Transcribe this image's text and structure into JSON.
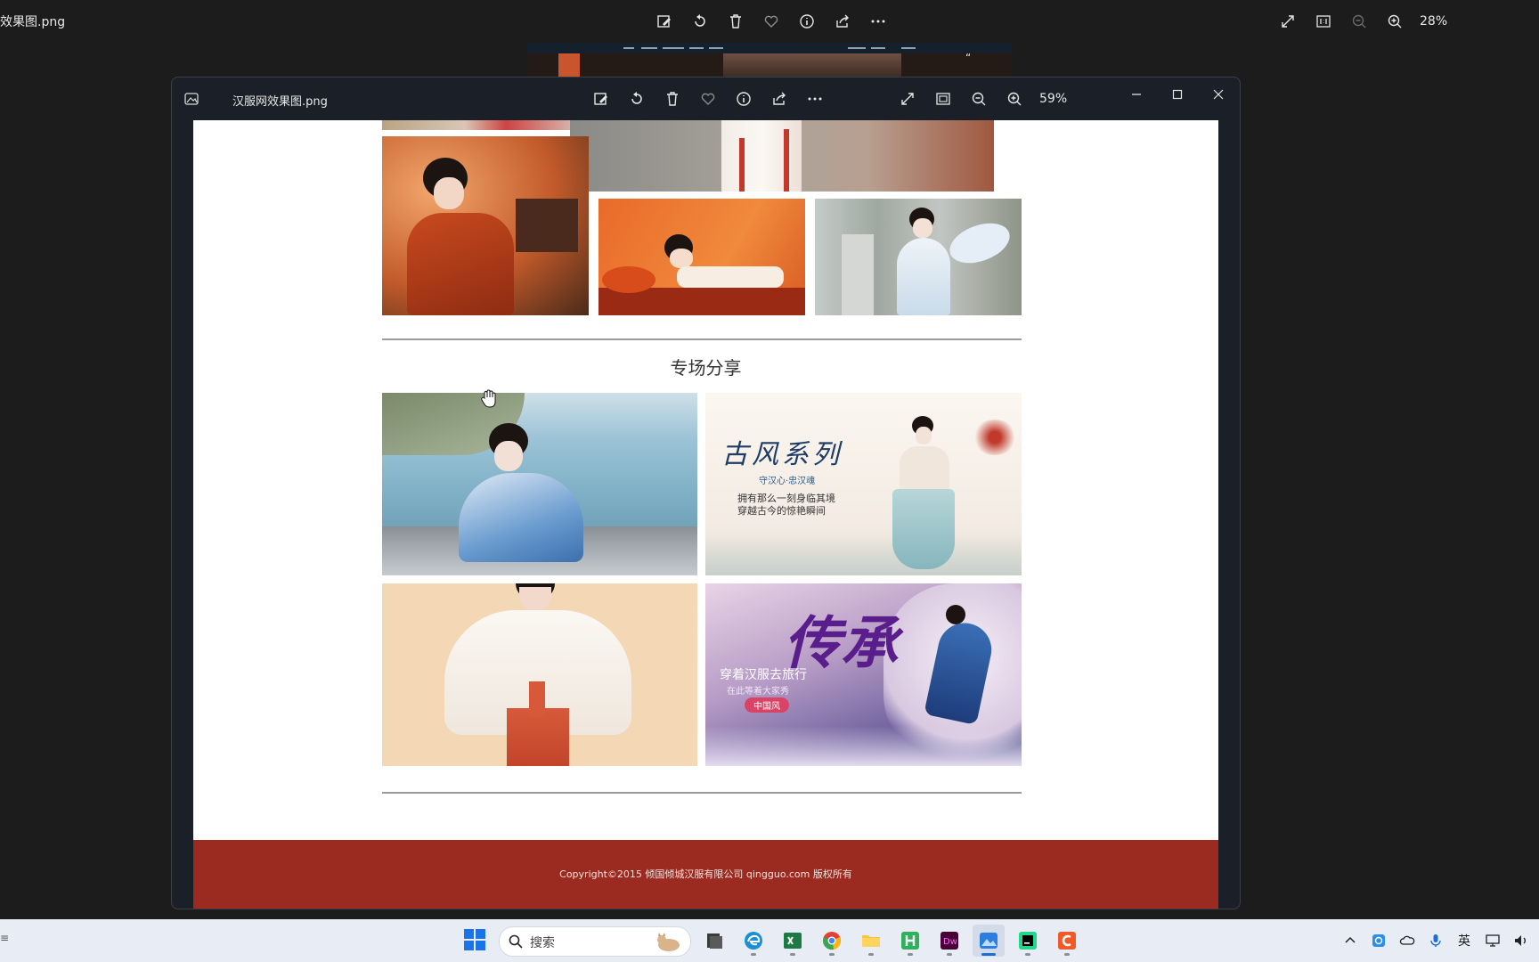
{
  "background_viewer": {
    "title": "效果图.png",
    "zoom": "28%",
    "toolbar": [
      "edit-icon",
      "rotate-icon",
      "delete-icon",
      "favorite-icon",
      "info-icon",
      "share-icon",
      "more-icon"
    ],
    "right_tools": [
      "fullscreen-icon",
      "actual-size-icon",
      "zoom-out-icon",
      "zoom-in-icon"
    ],
    "preview_quote": "“"
  },
  "viewer": {
    "title": "汉服网效果图.png",
    "zoom": "59%",
    "toolbar": [
      "edit-icon",
      "rotate-icon",
      "delete-icon",
      "favorite-icon",
      "info-icon",
      "share-icon",
      "more-icon"
    ],
    "zoom_tools": [
      "fullscreen-icon",
      "fit-icon",
      "zoom-out-icon",
      "zoom-in-icon"
    ],
    "window_controls": [
      "minimize-icon",
      "maximize-icon",
      "close-icon"
    ]
  },
  "page": {
    "section_title": "专场分享",
    "poster_1": {
      "title": "古风系列",
      "subtitle": "守汉心·忠汉魂",
      "line1": "拥有那么一刻身临其境",
      "line2": "穿越古今的惊艳瞬间"
    },
    "poster_2": {
      "title": "传承",
      "line1": "穿着汉服去旅行",
      "line2": "在此等着大家秀",
      "badge": "中国风"
    },
    "footer": "Copyright©2015 倾国倾城汉服有限公司 qingguo.com 版权所有"
  },
  "taskbar": {
    "search_placeholder": "搜索",
    "left_glyph": "≡",
    "ime_label": "英",
    "apps": [
      "explorer-icon",
      "edge-icon",
      "excel-icon",
      "chrome-icon",
      "folder-icon",
      "hbuilder-icon",
      "dreamweaver-icon",
      "photos-icon",
      "pycharm-icon",
      "app-icon"
    ],
    "tray": [
      "chevron-up-icon",
      "onedrive-sync-icon",
      "cloud-icon",
      "microphone-icon",
      "network-icon",
      "volume-icon"
    ]
  },
  "colors": {
    "footer_red": "#9b2a20",
    "window_bg": "#1b2028",
    "taskbar_bg": "#e7ecf5"
  }
}
